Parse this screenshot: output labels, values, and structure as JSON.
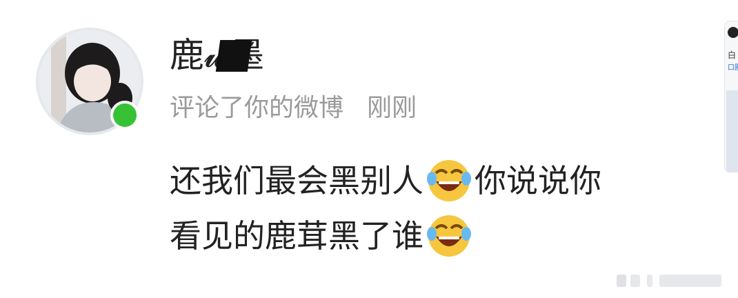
{
  "comment": {
    "username": "鹿𝔀墨",
    "action": "评论了你的微博",
    "time": "刚刚",
    "lines": [
      [
        "还我们最会黑别人",
        "emoji",
        "你说说你"
      ],
      [
        "看见的鹿茸黑了谁",
        "emoji"
      ]
    ],
    "emoji_name": "laugh-cry-emoji"
  },
  "colors": {
    "online": "#37c236",
    "meta_text": "#9a9a9a",
    "body_text": "#222222",
    "avatar_ring": "#e6e9ec"
  },
  "thumbnail": {
    "text": "白",
    "link": "口圖"
  }
}
